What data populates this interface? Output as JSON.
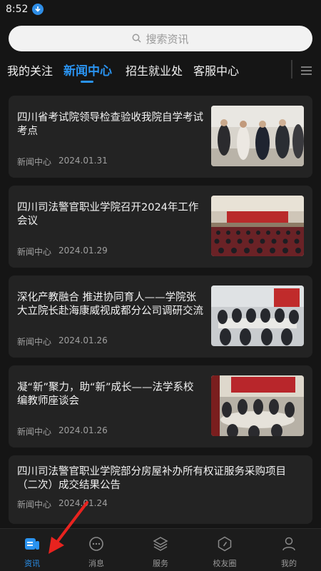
{
  "status": {
    "time": "8:52",
    "download_icon": "download-icon"
  },
  "search": {
    "placeholder": "搜索资讯"
  },
  "tabs": [
    {
      "label": "我的关注",
      "active": false
    },
    {
      "label": "新闻中心",
      "active": true
    },
    {
      "label": "招生就业处",
      "active": false
    },
    {
      "label": "客服中心",
      "active": false
    }
  ],
  "articles": [
    {
      "title": "四川省考试院领导检查验收我院自学考试考点",
      "category": "新闻中心",
      "date": "2024.01.31"
    },
    {
      "title": "四川司法警官职业学院召开2024年工作会议",
      "category": "新闻中心",
      "date": "2024.01.29"
    },
    {
      "title": "深化产教融合 推进协同育人——学院张大立院长赴海康威视成都分公司调研交流",
      "category": "新闻中心",
      "date": "2024.01.26"
    },
    {
      "title": "凝“新”聚力，助“新”成长——法学系校编教师座谈会",
      "category": "新闻中心",
      "date": "2024.01.26"
    },
    {
      "title": "四川司法警官职业学院部分房屋补办所有权证服务采购项目（二次）成交结果公告",
      "category": "新闻中心",
      "date": "2024.01.24"
    }
  ],
  "nav": [
    {
      "label": "资讯",
      "icon": "news-icon",
      "active": true
    },
    {
      "label": "消息",
      "icon": "message-icon",
      "active": false
    },
    {
      "label": "服务",
      "icon": "layers-icon",
      "active": false
    },
    {
      "label": "校友圈",
      "icon": "compass-icon",
      "active": false
    },
    {
      "label": "我的",
      "icon": "user-icon",
      "active": false
    }
  ],
  "colors": {
    "accent": "#2a93f0",
    "background": "#151515",
    "card": "#232323",
    "annotation_arrow": "#e8231f"
  }
}
